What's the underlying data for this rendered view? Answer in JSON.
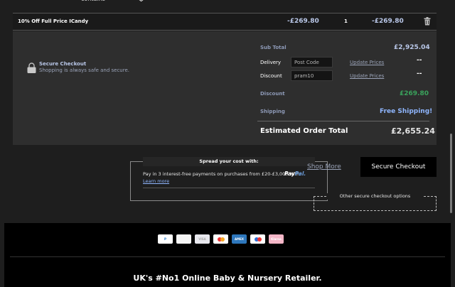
{
  "product": {
    "contains_label": "contains"
  },
  "discount_line": {
    "name": "10% Off Full Price ICandy",
    "price": "-£269.80",
    "qty": "1",
    "total": "-£269.80"
  },
  "secure": {
    "title": "Secure Checkout",
    "subtitle": "Shopping is always safe and secure."
  },
  "summary": {
    "subtotal_label": "Sub Total",
    "subtotal_value": "£2,925.04",
    "delivery_label": "Delivery",
    "postcode_placeholder": "Post Code",
    "update_prices_label": "Update Prices",
    "delivery_value": "--",
    "discount_label": "Discount",
    "discount_code_value": "pram10",
    "discount_value": "--",
    "discount_amount_label": "Discount",
    "discount_amount_value": "£269.80",
    "shipping_label": "Shipping",
    "shipping_value": "Free Shipping!",
    "estimated_label": "Estimated Order Total",
    "estimated_value": "£2,655.24"
  },
  "finance": {
    "heading": "Spread your cost with:",
    "text": "Pay in 3 interest-free payments on purchases from £20-£3,000 with",
    "brand_pay": "Pay",
    "brand_pal": "Pal.",
    "learn_more": "Learn more"
  },
  "actions": {
    "shop_more": "Shop More",
    "secure_checkout": "Secure Checkout",
    "other_options": "Other secure checkout options"
  },
  "footer": {
    "payment_methods": [
      {
        "name": "paypal-icon",
        "label": "P",
        "color": "#ffffff",
        "fg": "#1a73c9"
      },
      {
        "name": "card-generic-icon",
        "label": "",
        "color": "#f5f5f5",
        "fg": "#999"
      },
      {
        "name": "visa-icon",
        "label": "VISA",
        "color": "#e8e8ee",
        "fg": "#aaa"
      },
      {
        "name": "mastercard-icon",
        "label": "",
        "color": "#ffffff",
        "fg": "#e33"
      },
      {
        "name": "amex-icon",
        "label": "AMEX",
        "color": "#2e77bc",
        "fg": "#fff"
      },
      {
        "name": "maestro-icon",
        "label": "",
        "color": "#ffffff",
        "fg": "#e33"
      },
      {
        "name": "klarna-icon",
        "label": "Klarna",
        "color": "#f4b6c7",
        "fg": "#fff"
      }
    ],
    "tagline": "UK's #No1 Online Baby & Nursery Retailer."
  },
  "colors": {
    "accent_blue": "#b9c7e8",
    "discount_green": "#3aa35c",
    "shipping_blue": "#8fb6ff"
  }
}
